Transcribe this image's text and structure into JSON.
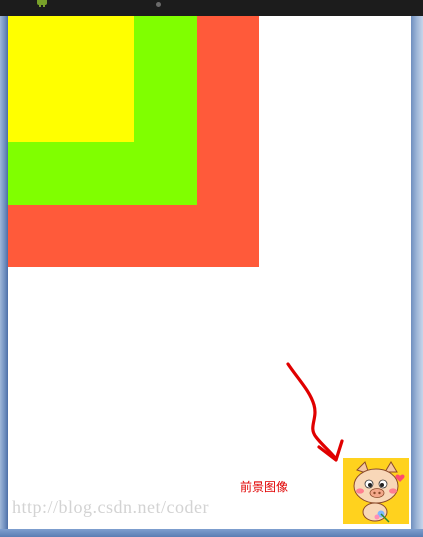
{
  "foreground_label": "前景图像",
  "watermark_text": "http://blog.csdn.net/coder",
  "colors": {
    "outer_square": "#ff5a3a",
    "middle_square": "#80ff00",
    "inner_square": "#ffff00",
    "arrow": "#e00000",
    "label": "#e00000"
  },
  "icons": {
    "titlebar_icon": "android-icon",
    "menu_icon": "menu-dot-icon",
    "foreground_image": "pig-cartoon-image"
  }
}
